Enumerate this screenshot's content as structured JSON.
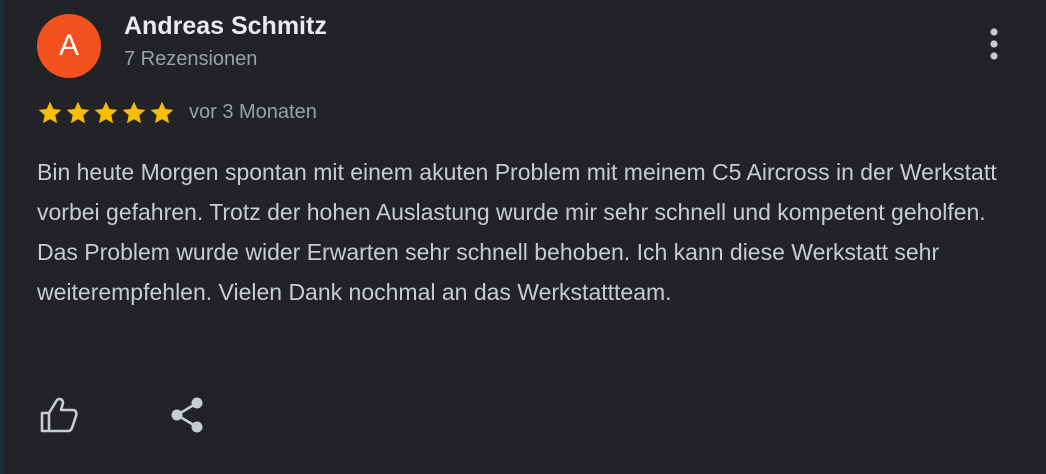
{
  "review": {
    "avatar_letter": "A",
    "author_name": "Andreas Schmitz",
    "review_count": "7 Rezensionen",
    "rating": 5,
    "rating_max": 5,
    "date": "vor 3 Monaten",
    "text": "Bin heute Morgen spontan mit einem akuten Problem mit meinem C5 Aircross in der Werkstatt vorbei gefahren. Trotz der hohen Auslastung wurde mir sehr schnell und kompetent geholfen. Das Problem wurde wider Erwarten sehr schnell behoben. Ich kann diese Werkstatt sehr weiterempfehlen. Vielen Dank nochmal an das Werkstattteam."
  },
  "icons": {
    "more": "more-vert-icon",
    "star": "star-icon",
    "like": "thumb-up-icon",
    "share": "share-icon"
  },
  "colors": {
    "background": "#222326",
    "avatar": "#f3511e",
    "star": "#fbbc04",
    "name": "#e8eaed",
    "secondary_text": "#9aa0a6",
    "body_text": "#c8ccd0",
    "icon": "#c8ccd0"
  }
}
